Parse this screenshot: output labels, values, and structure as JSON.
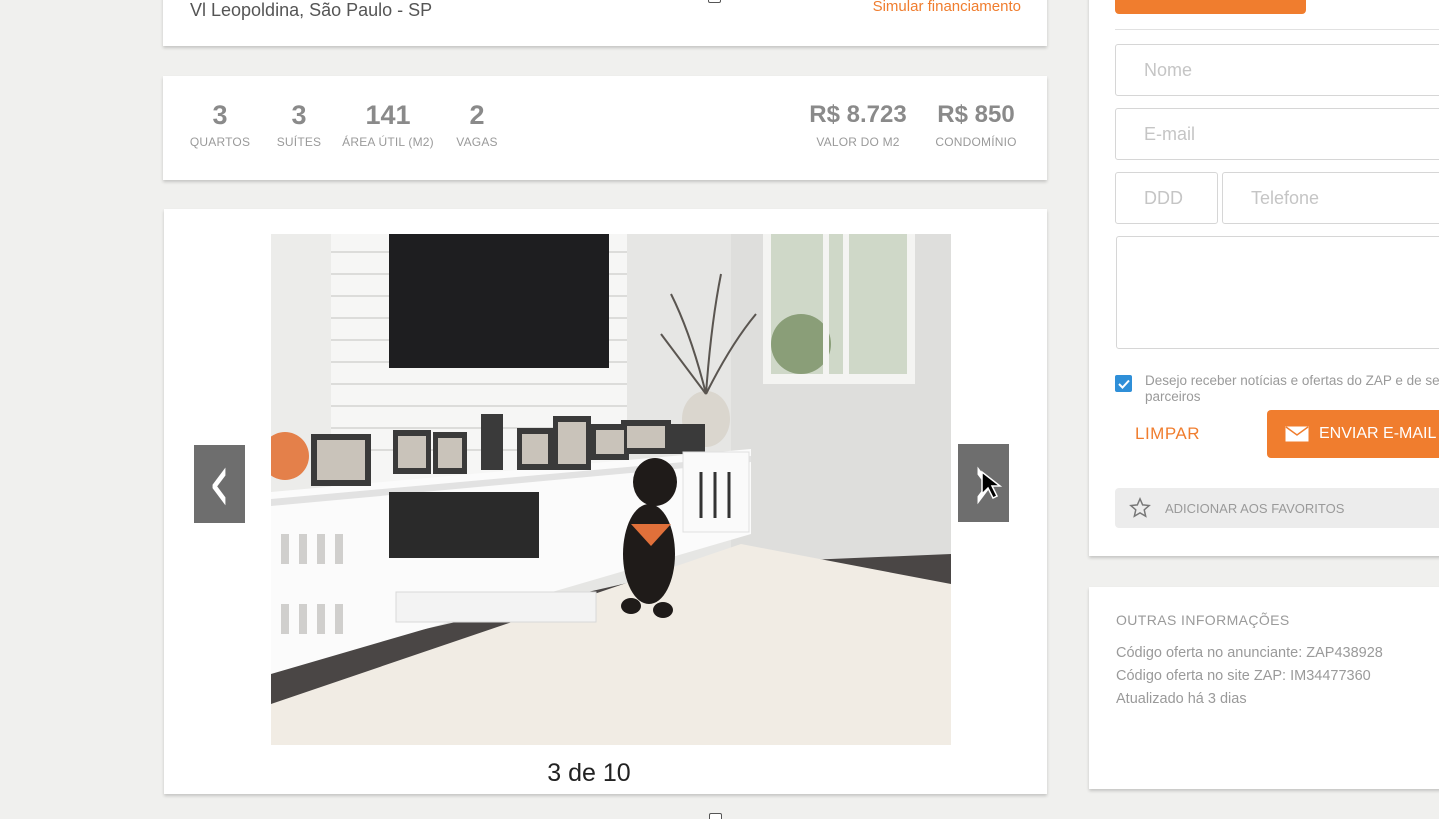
{
  "header": {
    "address": "Vl Leopoldina, São Paulo - SP",
    "simulate_link": "Simular financiamento"
  },
  "stats": {
    "items": [
      {
        "value": "3",
        "label": "QUARTOS"
      },
      {
        "value": "3",
        "label": "SUÍTES"
      },
      {
        "value": "141",
        "label": "ÁREA ÚTIL (M2)"
      },
      {
        "value": "2",
        "label": "VAGAS"
      }
    ],
    "prices": [
      {
        "value": "R$ 8.723",
        "label": "VALOR DO M2"
      },
      {
        "value": "R$ 850",
        "label": "CONDOMÍNIO"
      }
    ]
  },
  "gallery": {
    "prev_icon": "chevron-left-icon",
    "next_icon": "chevron-right-icon",
    "prev_glyph": "‹",
    "next_glyph": "›",
    "counter": "3 de 10"
  },
  "contact_form": {
    "name_placeholder": "Nome",
    "email_placeholder": "E-mail",
    "ddd_placeholder": "DDD",
    "phone_placeholder": "Telefone",
    "message_value": "",
    "newsletter_checked": true,
    "newsletter_text": "Desejo receber notícias e ofertas do ZAP e de seus parceiros",
    "clear_label": "LIMPAR",
    "send_label": "ENVIAR E-MAIL",
    "favorite_label": "ADICIONAR AOS FAVORITOS"
  },
  "other_info": {
    "title": "OUTRAS INFORMAÇÕES",
    "lines": [
      "Código oferta no anunciante: ZAP438928",
      "Código oferta no site ZAP: IM34477360",
      "Atualizado há 3 dias"
    ]
  },
  "colors": {
    "accent": "#f07d2e",
    "checkbox": "#2f8fd8",
    "arrow_bg": "#6e6e6e"
  }
}
